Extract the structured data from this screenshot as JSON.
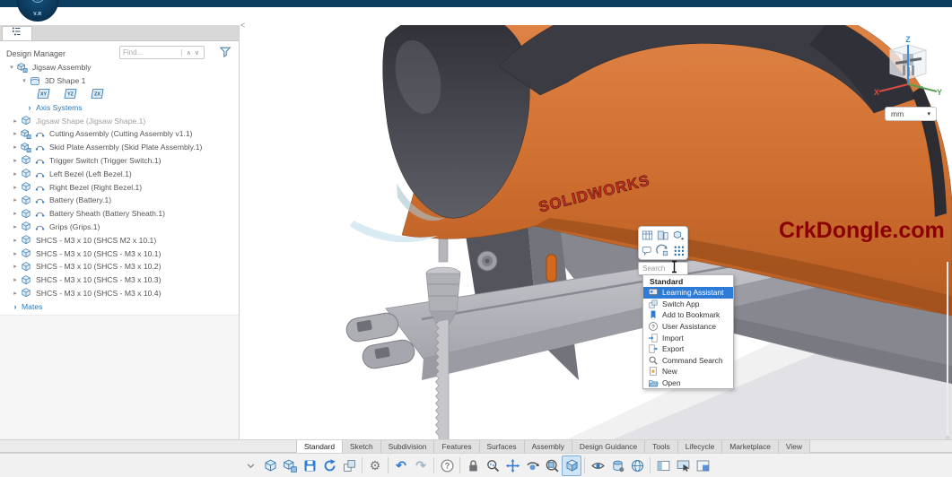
{
  "header": {
    "version_label": "V.R",
    "logo": "3dexperience-compass-icon"
  },
  "panel": {
    "title": "Design Manager",
    "collapse_label": "<",
    "find_placeholder": "Find...",
    "tab_icon": "tree-structure-icon",
    "filter_icon": "filter-funnel-icon",
    "tree": [
      {
        "label": "Jigsaw Assembly",
        "kind": "root",
        "icon": "assembly-icon",
        "arrow": "down"
      },
      {
        "label": "3D Shape 1",
        "kind": "shape",
        "icon": "shape-icon",
        "arrow": "down"
      },
      {
        "kind": "planes",
        "planes": [
          "XY",
          "YZ",
          "ZX"
        ]
      },
      {
        "label": "Axis Systems",
        "kind": "axislink",
        "arrow": "blue"
      },
      {
        "label": "Jigsaw Shape (Jigsaw Shape.1)",
        "kind": "comp",
        "icon": "part-icon",
        "arrow": "right",
        "muted": true
      },
      {
        "label": "Cutting Assembly (Cutting Assembly v1.1)",
        "kind": "comp",
        "icon": "assembly-icon",
        "arrow": "right",
        "link": true
      },
      {
        "label": "Skid Plate Assembly (Skid Plate Assembly.1)",
        "kind": "comp",
        "icon": "assembly-icon",
        "arrow": "right",
        "link": true
      },
      {
        "label": "Trigger Switch (Trigger Switch.1)",
        "kind": "comp",
        "icon": "part-icon",
        "arrow": "right",
        "link": true
      },
      {
        "label": "Left Bezel (Left Bezel.1)",
        "kind": "comp",
        "icon": "part-icon",
        "arrow": "right",
        "link": true
      },
      {
        "label": "Right Bezel (Right Bezel.1)",
        "kind": "comp",
        "icon": "part-icon",
        "arrow": "right",
        "link": true
      },
      {
        "label": "Battery (Battery.1)",
        "kind": "comp",
        "icon": "part-icon",
        "arrow": "right",
        "link": true
      },
      {
        "label": "Battery Sheath (Battery Sheath.1)",
        "kind": "comp",
        "icon": "part-icon",
        "arrow": "right",
        "link": true
      },
      {
        "label": "Grips (Grips.1)",
        "kind": "comp",
        "icon": "part-icon",
        "arrow": "right",
        "link": true
      },
      {
        "label": "SHCS - M3 x 10 (SHCS M2 x 10.1)",
        "kind": "comp",
        "icon": "part-icon",
        "arrow": "right"
      },
      {
        "label": "SHCS - M3 x 10 (SHCS - M3 x 10.1)",
        "kind": "comp",
        "icon": "part-icon",
        "arrow": "right"
      },
      {
        "label": "SHCS - M3 x 10 (SHCS - M3 x 10.2)",
        "kind": "comp",
        "icon": "part-icon",
        "arrow": "right"
      },
      {
        "label": "SHCS - M3 x 10 (SHCS - M3 x 10.3)",
        "kind": "comp",
        "icon": "part-icon",
        "arrow": "right"
      },
      {
        "label": "SHCS - M3 x 10 (SHCS - M3 x 10.4)",
        "kind": "comp",
        "icon": "part-icon",
        "arrow": "right"
      },
      {
        "label": "Mates",
        "kind": "mates",
        "arrow": "blue"
      }
    ]
  },
  "viewport": {
    "brand": "SOLIDWORKS",
    "watermark": "CrkDongle.com",
    "units_value": "mm",
    "axes": {
      "x": "X",
      "y": "Y",
      "z": "Z"
    },
    "axis_colors": {
      "x": "#d84b40",
      "y": "#56a050",
      "z": "#3f8fd6"
    }
  },
  "palette": {
    "icons": [
      "insert-table-icon",
      "split-view-icon",
      "insert-component-icon",
      "annotation-icon",
      "measure-icon",
      "pattern-icon"
    ],
    "search_placeholder": "Search"
  },
  "menu": {
    "header": "Standard",
    "items": [
      {
        "label": "Learning Assistant",
        "icon": "learning-assistant-icon",
        "selected": true
      },
      {
        "label": "Switch App",
        "icon": "switch-app-icon"
      },
      {
        "label": "Add to Bookmark",
        "icon": "bookmark-icon"
      },
      {
        "label": "User Assistance",
        "icon": "help-icon"
      },
      {
        "label": "Import",
        "icon": "import-icon"
      },
      {
        "label": "Export",
        "icon": "export-icon"
      },
      {
        "label": "Command Search",
        "icon": "search-icon"
      },
      {
        "label": "New",
        "icon": "new-icon"
      },
      {
        "label": "Open",
        "icon": "open-icon"
      }
    ]
  },
  "tabs": {
    "active": "Standard",
    "items": [
      "Standard",
      "Sketch",
      "Subdivision",
      "Features",
      "Surfaces",
      "Assembly",
      "Design Guidance",
      "Tools",
      "Lifecycle",
      "Marketplace",
      "View"
    ]
  },
  "toolbar": {
    "items": [
      {
        "icon": "chevron-down-icon"
      },
      {
        "icon": "part-icon"
      },
      {
        "icon": "assembly-icon"
      },
      {
        "icon": "save-icon"
      },
      {
        "icon": "sync-icon"
      },
      {
        "icon": "switch-app-icon"
      },
      {
        "divider": true
      },
      {
        "icon": "gear-icon"
      },
      {
        "divider": true
      },
      {
        "icon": "undo-icon"
      },
      {
        "icon": "redo-icon"
      },
      {
        "divider": true
      },
      {
        "icon": "help-icon"
      },
      {
        "divider": true
      },
      {
        "icon": "lock-icon"
      },
      {
        "icon": "zoom-icon"
      },
      {
        "icon": "pan-icon"
      },
      {
        "icon": "rotate-icon"
      },
      {
        "icon": "zoom-fit-icon"
      },
      {
        "icon": "view-cube-icon",
        "selected": true
      },
      {
        "divider": true
      },
      {
        "icon": "eye-icon"
      },
      {
        "icon": "section-icon"
      },
      {
        "icon": "globe-icon"
      },
      {
        "divider": true
      },
      {
        "icon": "panel-left-icon"
      },
      {
        "icon": "panel-pointer-icon"
      },
      {
        "icon": "panel-grid-icon"
      }
    ]
  }
}
